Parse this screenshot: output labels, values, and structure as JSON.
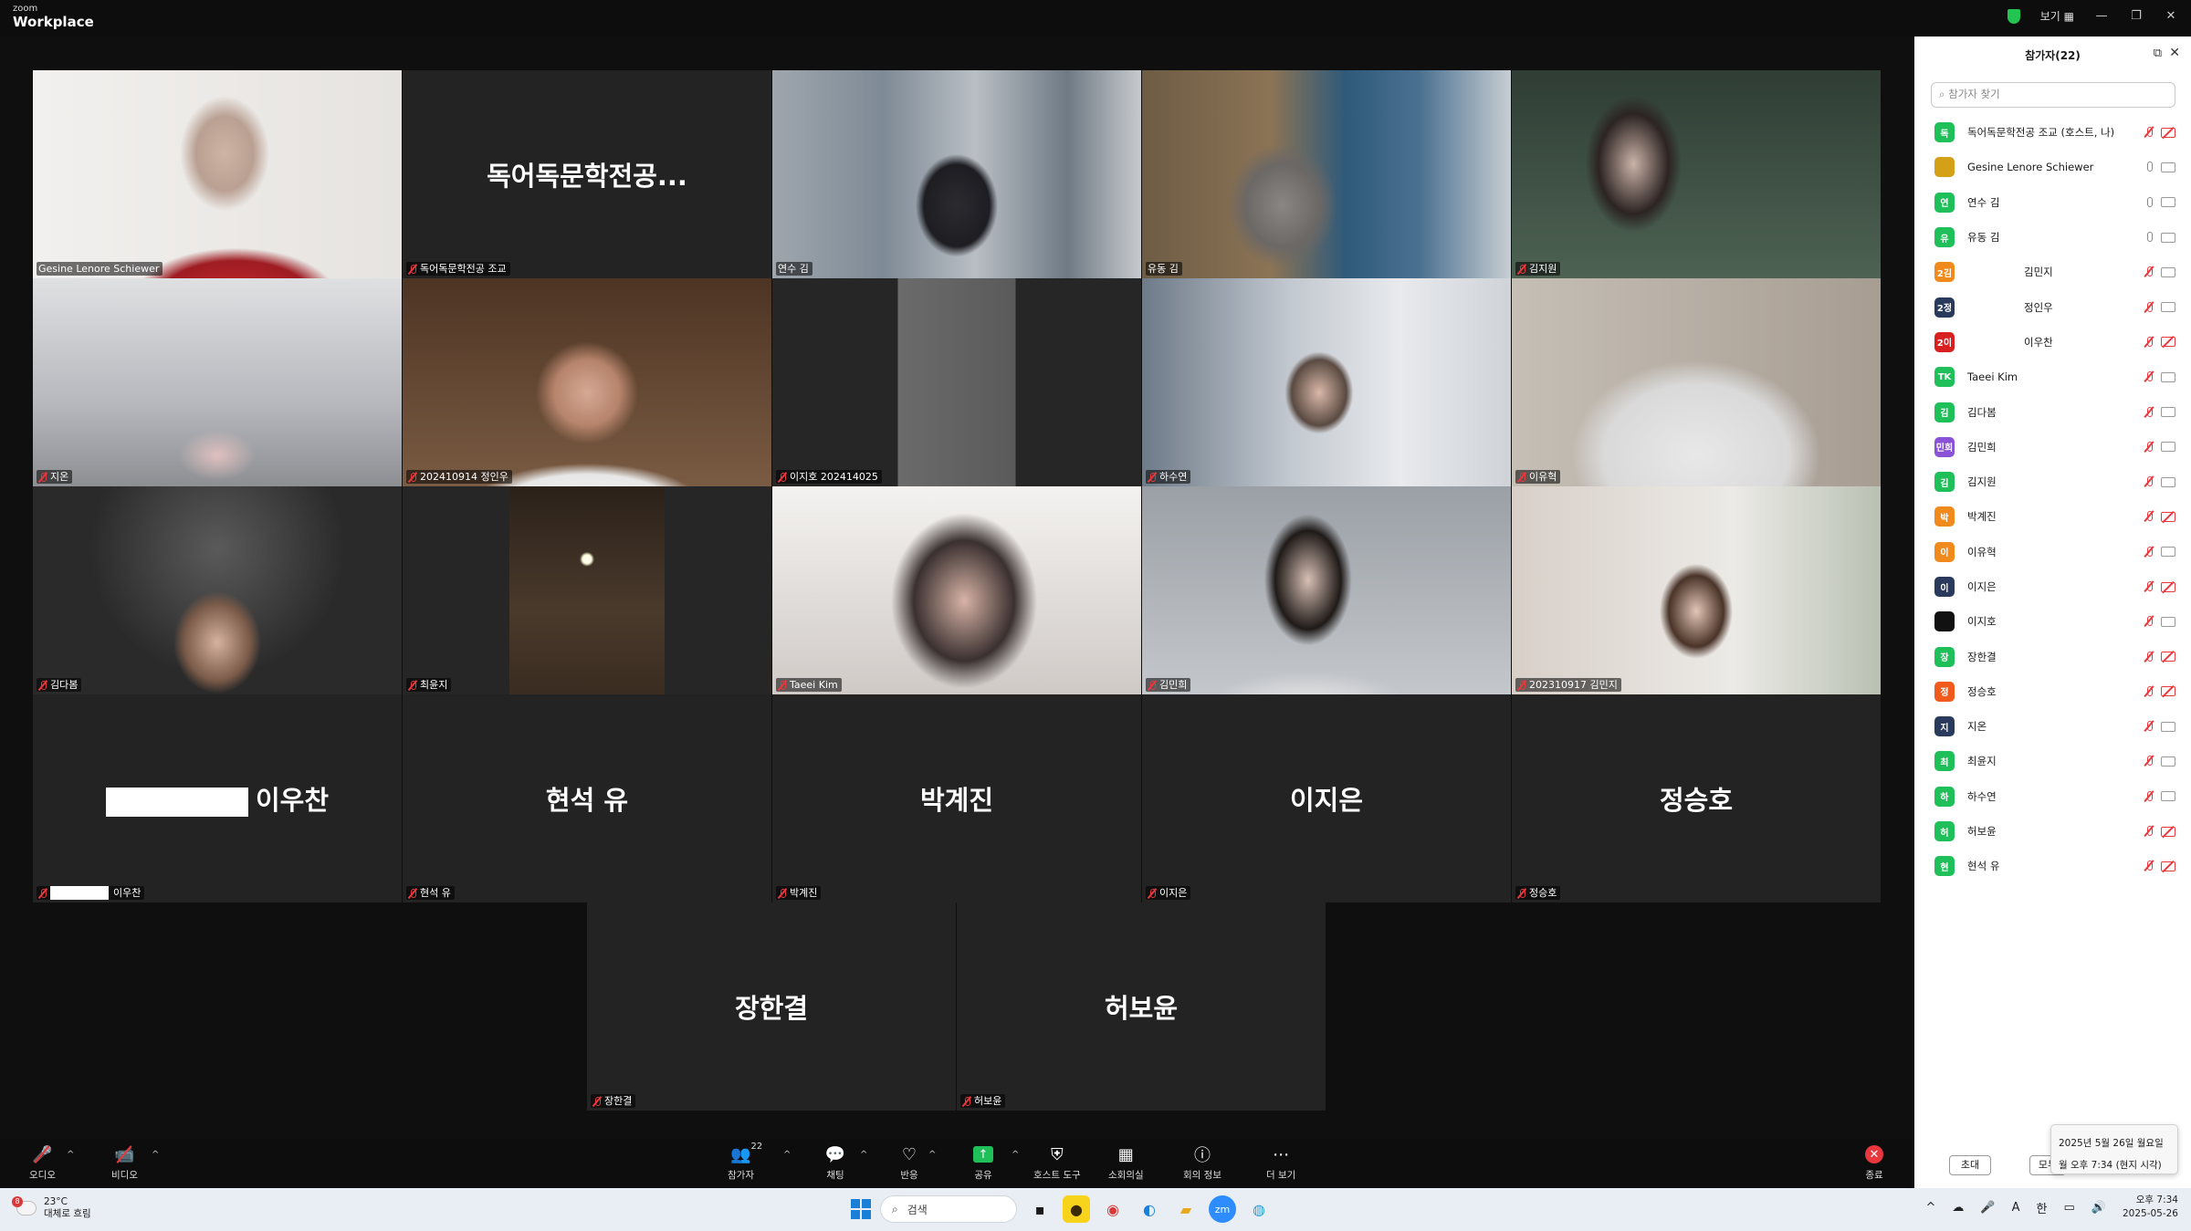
{
  "app": {
    "logo_small": "zoom",
    "logo_big": "Workplace",
    "view_label": "보기"
  },
  "colors": {
    "active_speaker": "#2ed18f",
    "mic_off": "#e8383d",
    "share_green": "#1fbf5a",
    "end_red": "#e8383d"
  },
  "tiles": [
    {
      "name": "Gesine Lenore Schiewer",
      "muted": false,
      "big": ""
    },
    {
      "name": "독어독문학전공 조교",
      "muted": true,
      "big": "독어독문학전공..."
    },
    {
      "name": "연수 김",
      "muted": false,
      "big": ""
    },
    {
      "name": "유동 김",
      "muted": false,
      "big": ""
    },
    {
      "name": "김지원",
      "muted": true,
      "big": ""
    },
    {
      "name": "지온",
      "muted": true,
      "big": ""
    },
    {
      "name": "202410914 정인우",
      "muted": true,
      "big": ""
    },
    {
      "name": "이지호 202414025",
      "muted": true,
      "big": ""
    },
    {
      "name": "하수연",
      "muted": true,
      "big": ""
    },
    {
      "name": "이유혁",
      "muted": true,
      "big": ""
    },
    {
      "name": "김다봄",
      "muted": true,
      "big": ""
    },
    {
      "name": "최윤지",
      "muted": true,
      "big": ""
    },
    {
      "name": "Taeei Kim",
      "muted": true,
      "big": ""
    },
    {
      "name": "김민희",
      "muted": true,
      "big": ""
    },
    {
      "name": "202310917 김민지",
      "muted": true,
      "big": ""
    },
    {
      "name": "이우찬",
      "muted": true,
      "big": "이우찬"
    },
    {
      "name": "현석 유",
      "muted": true,
      "big": "현석 유"
    },
    {
      "name": "박계진",
      "muted": true,
      "big": "박계진"
    },
    {
      "name": "이지은",
      "muted": true,
      "big": "이지은"
    },
    {
      "name": "정승호",
      "muted": true,
      "big": "정승호"
    },
    {
      "name": "장한결",
      "muted": true,
      "big": "장한결"
    },
    {
      "name": "허보윤",
      "muted": true,
      "big": "허보윤"
    }
  ],
  "toolbar": {
    "audio": "오디오",
    "video": "비디오",
    "participants": "참가자",
    "participants_count": "22",
    "chat": "채팅",
    "reactions": "반응",
    "share": "공유",
    "host_tools": "호스트 도구",
    "breakout": "소회의실",
    "meeting_info": "회의 정보",
    "more": "더 보기",
    "end": "종료"
  },
  "panel": {
    "title": "참가자(22)",
    "search_placeholder": "참가자 찾기",
    "invite": "초대",
    "more": "모두",
    "participants": [
      {
        "avatar": "독",
        "color": "#1fbf5a",
        "name": "독어독문학전공 조교 (호스트, 나)",
        "mic": "off",
        "cam": "off",
        "center": false
      },
      {
        "avatar": "",
        "color": "#d4a017",
        "name": "Gesine Lenore Schiewer",
        "mic": "on",
        "cam": "on",
        "center": false
      },
      {
        "avatar": "연",
        "color": "#1fbf5a",
        "name": "연수 김",
        "mic": "on",
        "cam": "on",
        "center": false
      },
      {
        "avatar": "유",
        "color": "#1fbf5a",
        "name": "유동 김",
        "mic": "on",
        "cam": "on",
        "center": false
      },
      {
        "avatar": "2김",
        "color": "#f08a1c",
        "name": "김민지",
        "mic": "off",
        "cam": "on",
        "center": true
      },
      {
        "avatar": "2정",
        "color": "#2a3a5c",
        "name": "정인우",
        "mic": "off",
        "cam": "on",
        "center": true
      },
      {
        "avatar": "2이",
        "color": "#d92020",
        "name": "이우찬",
        "mic": "off",
        "cam": "off",
        "center": true
      },
      {
        "avatar": "TK",
        "color": "#1fbf5a",
        "name": "Taeei Kim",
        "mic": "off",
        "cam": "on",
        "center": false
      },
      {
        "avatar": "김",
        "color": "#1fbf5a",
        "name": "김다봄",
        "mic": "off",
        "cam": "on",
        "center": false
      },
      {
        "avatar": "민희",
        "color": "#8a52d6",
        "name": "김민희",
        "mic": "off",
        "cam": "on",
        "center": false
      },
      {
        "avatar": "김",
        "color": "#1fbf5a",
        "name": "김지원",
        "mic": "off",
        "cam": "on",
        "center": false
      },
      {
        "avatar": "박",
        "color": "#f08a1c",
        "name": "박계진",
        "mic": "off",
        "cam": "off",
        "center": false
      },
      {
        "avatar": "이",
        "color": "#f08a1c",
        "name": "이유혁",
        "mic": "off",
        "cam": "on",
        "center": false
      },
      {
        "avatar": "이",
        "color": "#2a3a5c",
        "name": "이지은",
        "mic": "off",
        "cam": "off",
        "center": false
      },
      {
        "avatar": "",
        "color": "#111111",
        "name": "이지호",
        "mic": "off",
        "cam": "on",
        "center": false
      },
      {
        "avatar": "장",
        "color": "#1fbf5a",
        "name": "장한결",
        "mic": "off",
        "cam": "off",
        "center": false
      },
      {
        "avatar": "정",
        "color": "#f05a1c",
        "name": "정승호",
        "mic": "off",
        "cam": "off",
        "center": false
      },
      {
        "avatar": "지",
        "color": "#2a3a5c",
        "name": "지온",
        "mic": "off",
        "cam": "on",
        "center": false
      },
      {
        "avatar": "최",
        "color": "#1fbf5a",
        "name": "최윤지",
        "mic": "off",
        "cam": "on",
        "center": false
      },
      {
        "avatar": "하",
        "color": "#1fbf5a",
        "name": "하수연",
        "mic": "off",
        "cam": "on",
        "center": false
      },
      {
        "avatar": "허",
        "color": "#1fbf5a",
        "name": "허보윤",
        "mic": "off",
        "cam": "off",
        "center": false
      },
      {
        "avatar": "현",
        "color": "#1fbf5a",
        "name": "현석 유",
        "mic": "off",
        "cam": "off",
        "center": false
      }
    ]
  },
  "clock_tooltip": {
    "date": "2025년 5월 26일 월요일",
    "time": "월 오후 7:34 (현지 시각)"
  },
  "taskbar": {
    "weather_badge": "8",
    "temp": "23°C",
    "weather": "대체로 흐림",
    "search": "검색",
    "ime": "한",
    "lang": "A",
    "time": "오후 7:34",
    "date": "2025-05-26"
  }
}
